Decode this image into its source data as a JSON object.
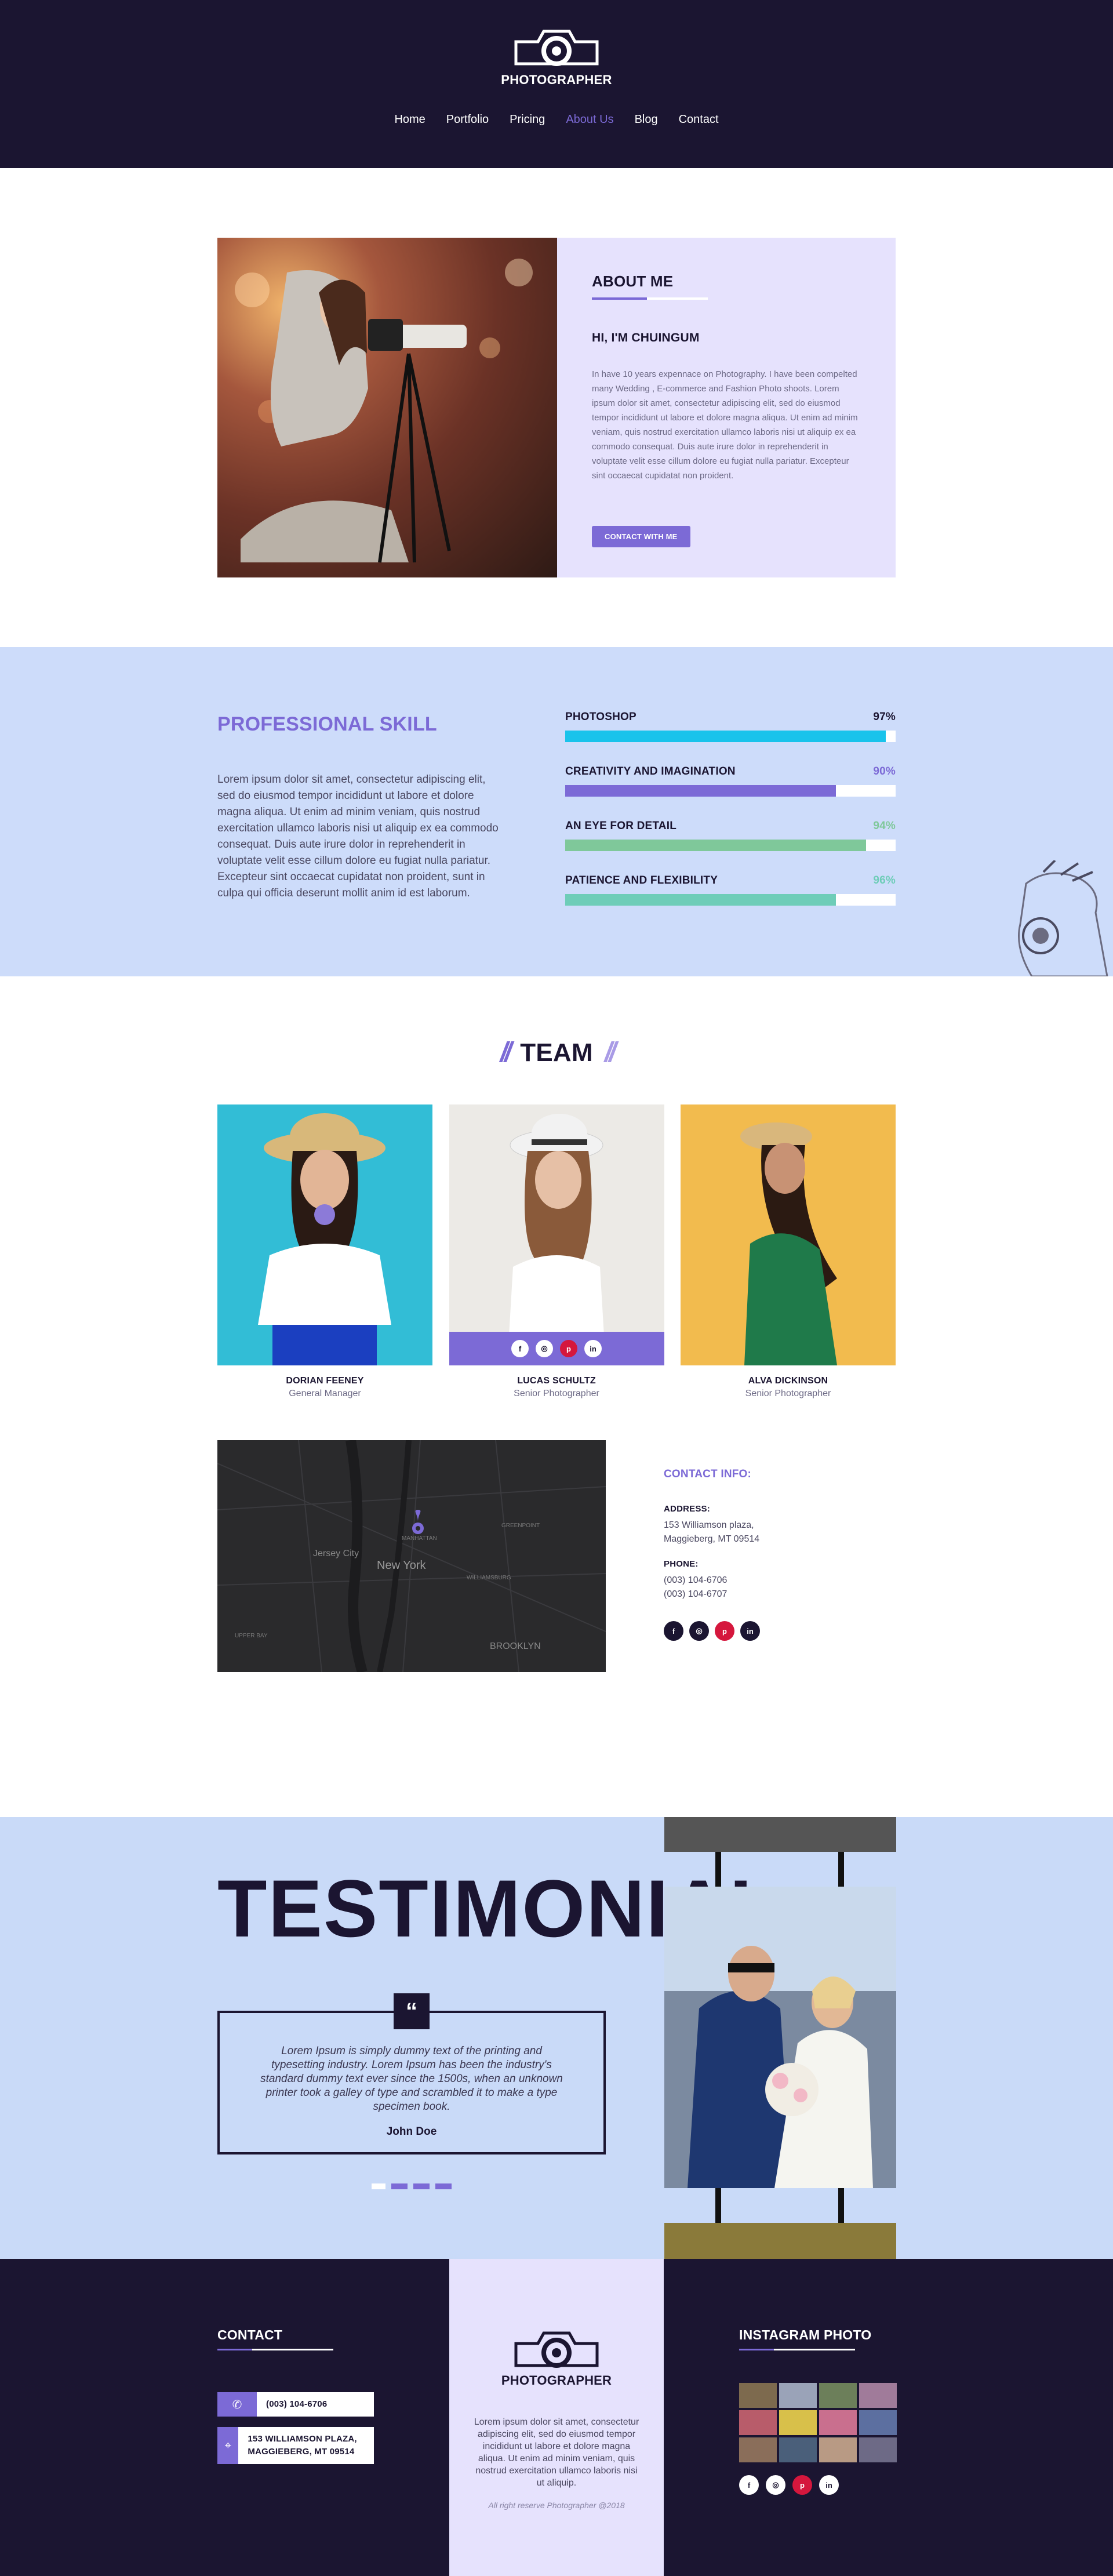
{
  "header": {
    "brand": "PHOTOGRAPHER",
    "nav": [
      "Home",
      "Portfolio",
      "Pricing",
      "About Us",
      "Blog",
      "Contact"
    ],
    "active_nav": "About Us"
  },
  "about": {
    "title": "ABOUT ME",
    "subtitle": "HI, I'M CHUINGUM",
    "text": "In have 10 years expennace on Photography. I have been compelted many Wedding , E-commerce and Fashion Photo shoots. Lorem ipsum dolor sit amet, consectetur adipiscing elit, sed do eiusmod tempor incididunt ut labore et dolore magna aliqua. Ut enim ad minim veniam, quis nostrud exercitation ullamco laboris nisi ut aliquip ex ea commodo consequat. Duis aute irure dolor in reprehenderit in voluptate velit esse cillum dolore eu fugiat nulla pariatur. Excepteur sint occaecat cupidatat non proident.",
    "button": "CONTACT WITH ME"
  },
  "skill": {
    "title": "PROFESSIONAL SKILL",
    "text": "Lorem ipsum dolor sit amet, consectetur adipiscing elit, sed do eiusmod tempor incididunt ut labore et dolore magna aliqua. Ut enim ad minim veniam, quis nostrud exercitation ullamco laboris nisi ut aliquip ex ea commodo consequat. Duis aute irure dolor in reprehenderit in voluptate velit esse cillum dolore eu fugiat nulla pariatur. Excepteur sint occaecat cupidatat non proident, sunt in culpa qui officia deserunt mollit anim id est laborum.",
    "bars": [
      {
        "label": "PHOTOSHOP",
        "value": "97%",
        "percent": 97,
        "color": "#19c3eb",
        "pct_color": "#1b1531"
      },
      {
        "label": "CREATIVITY AND IMAGINATION",
        "value": "90%",
        "percent": 82,
        "color": "#7c6ad6",
        "pct_color": "#7c6ad6"
      },
      {
        "label": "AN EYE FOR DETAIL",
        "value": "94%",
        "percent": 91,
        "color": "#7fc89a",
        "pct_color": "#7fc89a"
      },
      {
        "label": "PATIENCE AND FLEXIBILITY",
        "value": "96%",
        "percent": 82,
        "color": "#6ecdb8",
        "pct_color": "#6ecdb8"
      }
    ]
  },
  "team": {
    "title": "TEAM",
    "members": [
      {
        "name": "DORIAN FEENEY",
        "role": "General Manager"
      },
      {
        "name": "LUCAS SCHULTZ",
        "role": "Senior Photographer"
      },
      {
        "name": "ALVA DICKINSON",
        "role": "Senior Photographer"
      }
    ],
    "social": [
      "f",
      "◎",
      "p",
      "in"
    ]
  },
  "map": {
    "labels": [
      "Jersey City",
      "New York",
      "BROOKLYN",
      "MANHATTAN",
      "WILLIAMSBURG",
      "GREENPOINT",
      "UPPER BAY"
    ]
  },
  "contact": {
    "title": "CONTACT INFO:",
    "address_label": "ADDRESS:",
    "address_1": "153 Williamson plaza,",
    "address_2": "Maggieberg, MT 09514",
    "phone_label": "PHONE:",
    "phone_1": "(003) 104-6706",
    "phone_2": "(003) 104-6707"
  },
  "testimonial": {
    "title": "TESTIMONIAL",
    "quote": "Lorem Ipsum is simply dummy text of the printing and typesetting industry. Lorem Ipsum has been the industry's standard dummy text ever since the 1500s, when an unknown printer took a galley of type and scrambled it to make a type specimen book.",
    "author": "John Doe"
  },
  "footer": {
    "contact_title": "CONTACT",
    "phone": "(003) 104-6706",
    "address": "153 WILLIAMSON PLAZA, MAGGIEBERG, MT 09514",
    "brand": "PHOTOGRAPHER",
    "about": "Lorem ipsum dolor sit amet, consectetur adipiscing elit, sed do eiusmod tempor incididunt ut labore et dolore magna aliqua. Ut enim ad minim veniam, quis nostrud exercitation ullamco laboris nisi ut aliquip.",
    "copyright": "All right reserve Photographer @2018",
    "instagram_title": "INSTAGRAM PHOTO"
  }
}
